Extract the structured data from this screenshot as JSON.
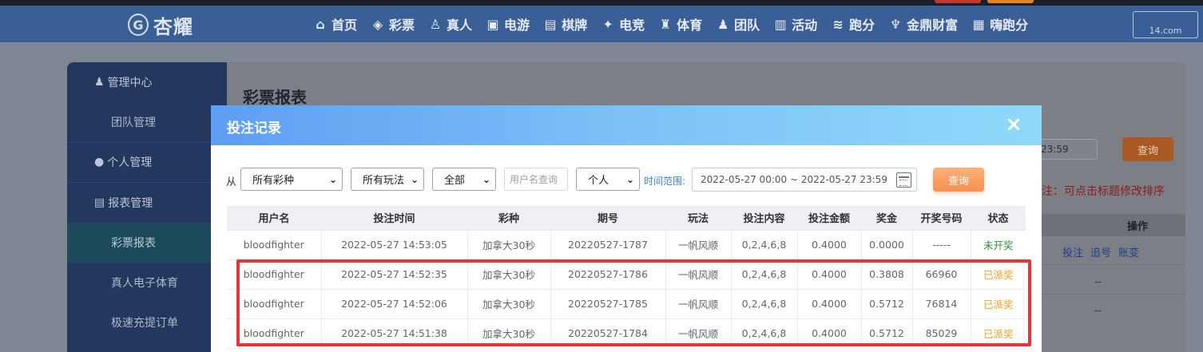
{
  "nav": {
    "logo": "杏耀",
    "items": [
      {
        "label": "首页",
        "icon": "home-icon",
        "glyph": "⌂"
      },
      {
        "label": "彩票",
        "icon": "lottery-icon",
        "glyph": "◈"
      },
      {
        "label": "真人",
        "icon": "live-icon",
        "glyph": "♙"
      },
      {
        "label": "电游",
        "icon": "arcade-icon",
        "glyph": "▣"
      },
      {
        "label": "棋牌",
        "icon": "cards-icon",
        "glyph": "▤"
      },
      {
        "label": "电竞",
        "icon": "gamepad-icon",
        "glyph": "✦"
      },
      {
        "label": "体育",
        "icon": "trophy-icon",
        "glyph": "♜"
      },
      {
        "label": "团队",
        "icon": "team-icon",
        "glyph": "♟"
      },
      {
        "label": "活动",
        "icon": "gift-icon",
        "glyph": "▥"
      },
      {
        "label": "跑分",
        "icon": "run-icon",
        "glyph": "≋"
      },
      {
        "label": "金鼎财富",
        "icon": "wealth-icon",
        "glyph": "♆"
      },
      {
        "label": "嗨跑分",
        "icon": "hi-icon",
        "glyph": "▦"
      }
    ],
    "badge": "14.com"
  },
  "sidebar": {
    "items": [
      {
        "label": "管理中心",
        "type": "head",
        "icon": "team-icon"
      },
      {
        "label": "团队管理",
        "type": "sub"
      },
      {
        "label": "个人管理",
        "type": "head",
        "icon": "user-icon"
      },
      {
        "label": "报表管理",
        "type": "head",
        "icon": "report-icon"
      },
      {
        "label": "彩票报表",
        "type": "sub",
        "active": true
      },
      {
        "label": "真人电子体育",
        "type": "sub"
      },
      {
        "label": "极速充提订单",
        "type": "sub"
      }
    ]
  },
  "page": {
    "title": "彩票报表",
    "date_tail": "23:59",
    "query_label": "查询",
    "note": "注：可点击标题修改排序",
    "actions_header": "操作",
    "actions": [
      "投注",
      "追号",
      "账变"
    ],
    "dash": "--"
  },
  "modal": {
    "title": "投注记录",
    "close": "×",
    "filters": {
      "from_label": "从",
      "lottery": "所有彩种",
      "play": "所有玩法",
      "scope": "全部",
      "username_placeholder": "用户名查询",
      "person": "个人",
      "range_label": "时间范围:",
      "range_value": "2022-05-27 00:00 ~ 2022-05-27 23:59",
      "query_label": "查询"
    },
    "table": {
      "columns": [
        "用户名",
        "投注时间",
        "彩种",
        "期号",
        "玩法",
        "投注内容",
        "投注金额",
        "奖金",
        "开奖号码",
        "状态"
      ],
      "rows": [
        [
          "bloodfighter",
          "2022-05-27 14:53:05",
          "加拿大30秒",
          "20220527-1787",
          "一帆风顺",
          "0,2,4,6,8",
          "0.4000",
          "0.0000",
          "-----",
          "未开奖"
        ],
        [
          "bloodfighter",
          "2022-05-27 14:52:35",
          "加拿大30秒",
          "20220527-1786",
          "一帆风顺",
          "0,2,4,6,8",
          "0.4000",
          "0.3808",
          "66960",
          "已派奖"
        ],
        [
          "bloodfighter",
          "2022-05-27 14:52:06",
          "加拿大30秒",
          "20220527-1785",
          "一帆风顺",
          "0,2,4,6,8",
          "0.4000",
          "0.5712",
          "76814",
          "已派奖"
        ],
        [
          "bloodfighter",
          "2022-05-27 14:51:38",
          "加拿大30秒",
          "20220527-1784",
          "一帆风顺",
          "0,2,4,6,8",
          "0.4000",
          "0.5712",
          "85029",
          "已派奖"
        ]
      ]
    }
  },
  "colors": {
    "status_pending": "#2d8f3c",
    "status_paid": "#f0a020",
    "highlight": "#e8333a",
    "accent": "#f59052"
  }
}
